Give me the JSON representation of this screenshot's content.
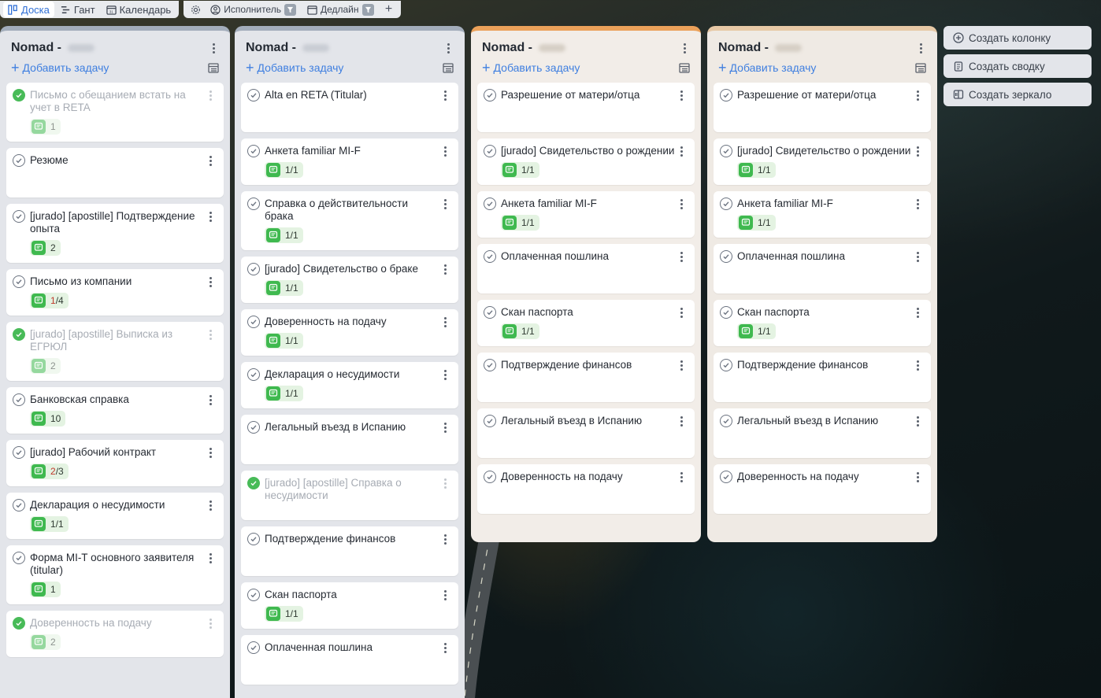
{
  "toolbar": {
    "views": [
      {
        "label": "Доска",
        "icon": "board-icon",
        "active": true
      },
      {
        "label": "Гант",
        "icon": "gantt-icon",
        "active": false
      },
      {
        "label": "Календарь",
        "icon": "calendar-icon",
        "active": false
      }
    ],
    "filters": [
      {
        "label": "Исполнитель",
        "icon": "user-icon"
      },
      {
        "label": "Дедлайн",
        "icon": "calendar-icon"
      }
    ]
  },
  "add_task_label": "Добавить задачу",
  "columns": [
    {
      "title": "Nomad -",
      "color": "#a3adbb",
      "cards": [
        {
          "title": "Письмо с обещанием встать на учет в RETA",
          "done": true,
          "badge": "1"
        },
        {
          "title": "Резюме",
          "done": false,
          "badge": ""
        },
        {
          "title": "[jurado] [apostille] Подтверждение опыта",
          "done": false,
          "badge": "2"
        },
        {
          "title": "Письмо из компании",
          "done": false,
          "badge": "1/4"
        },
        {
          "title": "[jurado] [apostille] Выписка из ЕГРЮЛ",
          "done": true,
          "badge": "2"
        },
        {
          "title": "Банковская справка",
          "done": false,
          "badge": "10"
        },
        {
          "title": "[jurado] Рабочий контракт",
          "done": false,
          "badge": "2/3"
        },
        {
          "title": "Декларация о несудимости",
          "done": false,
          "badge": "1/1"
        },
        {
          "title": "Форма MI-T основного заявителя (titular)",
          "done": false,
          "badge": "1"
        },
        {
          "title": "Доверенность на подачу",
          "done": true,
          "badge": "2"
        }
      ]
    },
    {
      "title": "Nomad -",
      "color": "#a3adbb",
      "cards": [
        {
          "title": "Alta en RETA (Titular)",
          "done": false,
          "badge": ""
        },
        {
          "title": "Анкета familiar MI-F",
          "done": false,
          "badge": "1/1"
        },
        {
          "title": "Справка о действительности брака",
          "done": false,
          "badge": "1/1"
        },
        {
          "title": "[jurado] Свидетельство о браке",
          "done": false,
          "badge": "1/1"
        },
        {
          "title": "Доверенность на подачу",
          "done": false,
          "badge": "1/1"
        },
        {
          "title": "Декларация о несудимости",
          "done": false,
          "badge": "1/1"
        },
        {
          "title": "Легальный въезд в Испанию",
          "done": false,
          "badge": ""
        },
        {
          "title": "[jurado] [apostille] Справка о несудимости",
          "done": true,
          "badge": ""
        },
        {
          "title": "Подтверждение финансов",
          "done": false,
          "badge": ""
        },
        {
          "title": "Скан паспорта",
          "done": false,
          "badge": "1/1"
        },
        {
          "title": "Оплаченная пошлина",
          "done": false,
          "badge": ""
        }
      ]
    },
    {
      "title": "Nomad -",
      "color": "#eba15a",
      "cards": [
        {
          "title": "Разрешение от матери/отца",
          "done": false,
          "badge": ""
        },
        {
          "title": "[jurado] Свидетельство о рождении",
          "done": false,
          "badge": "1/1"
        },
        {
          "title": "Анкета familiar MI-F",
          "done": false,
          "badge": "1/1"
        },
        {
          "title": "Оплаченная пошлина",
          "done": false,
          "badge": ""
        },
        {
          "title": "Скан паспорта",
          "done": false,
          "badge": "1/1"
        },
        {
          "title": "Подтверждение финансов",
          "done": false,
          "badge": ""
        },
        {
          "title": "Легальный въезд в Испанию",
          "done": false,
          "badge": ""
        },
        {
          "title": "Доверенность на подачу",
          "done": false,
          "badge": ""
        }
      ]
    },
    {
      "title": "Nomad -",
      "color": "#e7c9a6",
      "cards": [
        {
          "title": "Разрешение от матери/отца",
          "done": false,
          "badge": ""
        },
        {
          "title": "[jurado] Свидетельство о рождении",
          "done": false,
          "badge": "1/1"
        },
        {
          "title": "Анкета familiar MI-F",
          "done": false,
          "badge": "1/1"
        },
        {
          "title": "Оплаченная пошлина",
          "done": false,
          "badge": ""
        },
        {
          "title": "Скан паспорта",
          "done": false,
          "badge": "1/1"
        },
        {
          "title": "Подтверждение финансов",
          "done": false,
          "badge": ""
        },
        {
          "title": "Легальный въезд в Испанию",
          "done": false,
          "badge": ""
        },
        {
          "title": "Доверенность на подачу",
          "done": false,
          "badge": ""
        }
      ]
    }
  ],
  "side_buttons": [
    {
      "label": "Создать колонку",
      "icon": "plus-circle-icon"
    },
    {
      "label": "Создать сводку",
      "icon": "clipboard-icon"
    },
    {
      "label": "Создать зеркало",
      "icon": "mirror-icon"
    }
  ]
}
